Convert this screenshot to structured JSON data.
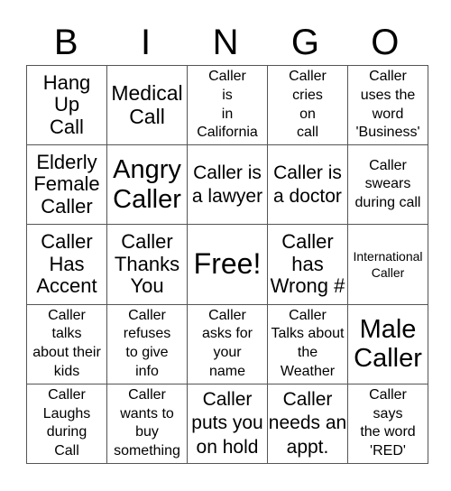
{
  "header": {
    "letters": [
      "B",
      "I",
      "N",
      "G",
      "O"
    ]
  },
  "grid": {
    "rows": [
      [
        {
          "text": "Hang\nUp\nCall",
          "size": "s22"
        },
        {
          "text": "Medical\nCall",
          "size": "s23"
        },
        {
          "text": "Caller\nis\nin\nCalifornia",
          "size": "s16"
        },
        {
          "text": "Caller\ncries\non\ncall",
          "size": "s16"
        },
        {
          "text": "Caller\nuses the\nword\n'Business'",
          "size": "s16"
        }
      ],
      [
        {
          "text": "Elderly\nFemale\nCaller",
          "size": "s22"
        },
        {
          "text": "Angry\nCaller",
          "size": "s28"
        },
        {
          "text": "Caller is\na lawyer",
          "size": "s21"
        },
        {
          "text": "Caller is\na doctor",
          "size": "s21"
        },
        {
          "text": "Caller\nswears\nduring call",
          "size": "s16"
        }
      ],
      [
        {
          "text": "Caller\nHas\nAccent",
          "size": "s22"
        },
        {
          "text": "Caller\nThanks\nYou",
          "size": "s22"
        },
        {
          "text": "Free!",
          "size": "s32"
        },
        {
          "text": "Caller\nhas\nWrong #",
          "size": "s22"
        },
        {
          "text": "International\nCaller",
          "size": "s13"
        }
      ],
      [
        {
          "text": "Caller\ntalks\nabout their\nkids",
          "size": "s16"
        },
        {
          "text": "Caller\nrefuses\nto give\ninfo",
          "size": "s16"
        },
        {
          "text": "Caller\nasks for\nyour\nname",
          "size": "s16"
        },
        {
          "text": "Caller\nTalks about\nthe\nWeather",
          "size": "s16"
        },
        {
          "text": "Male\nCaller",
          "size": "s28"
        }
      ],
      [
        {
          "text": "Caller\nLaughs\nduring\nCall",
          "size": "s16"
        },
        {
          "text": "Caller\nwants to\nbuy\nsomething",
          "size": "s16"
        },
        {
          "text": "Caller\nputs you\non hold",
          "size": "s21"
        },
        {
          "text": "Caller\nneeds an\nappt.",
          "size": "s21"
        },
        {
          "text": "Caller\nsays\nthe word\n'RED'",
          "size": "s16"
        }
      ]
    ]
  }
}
